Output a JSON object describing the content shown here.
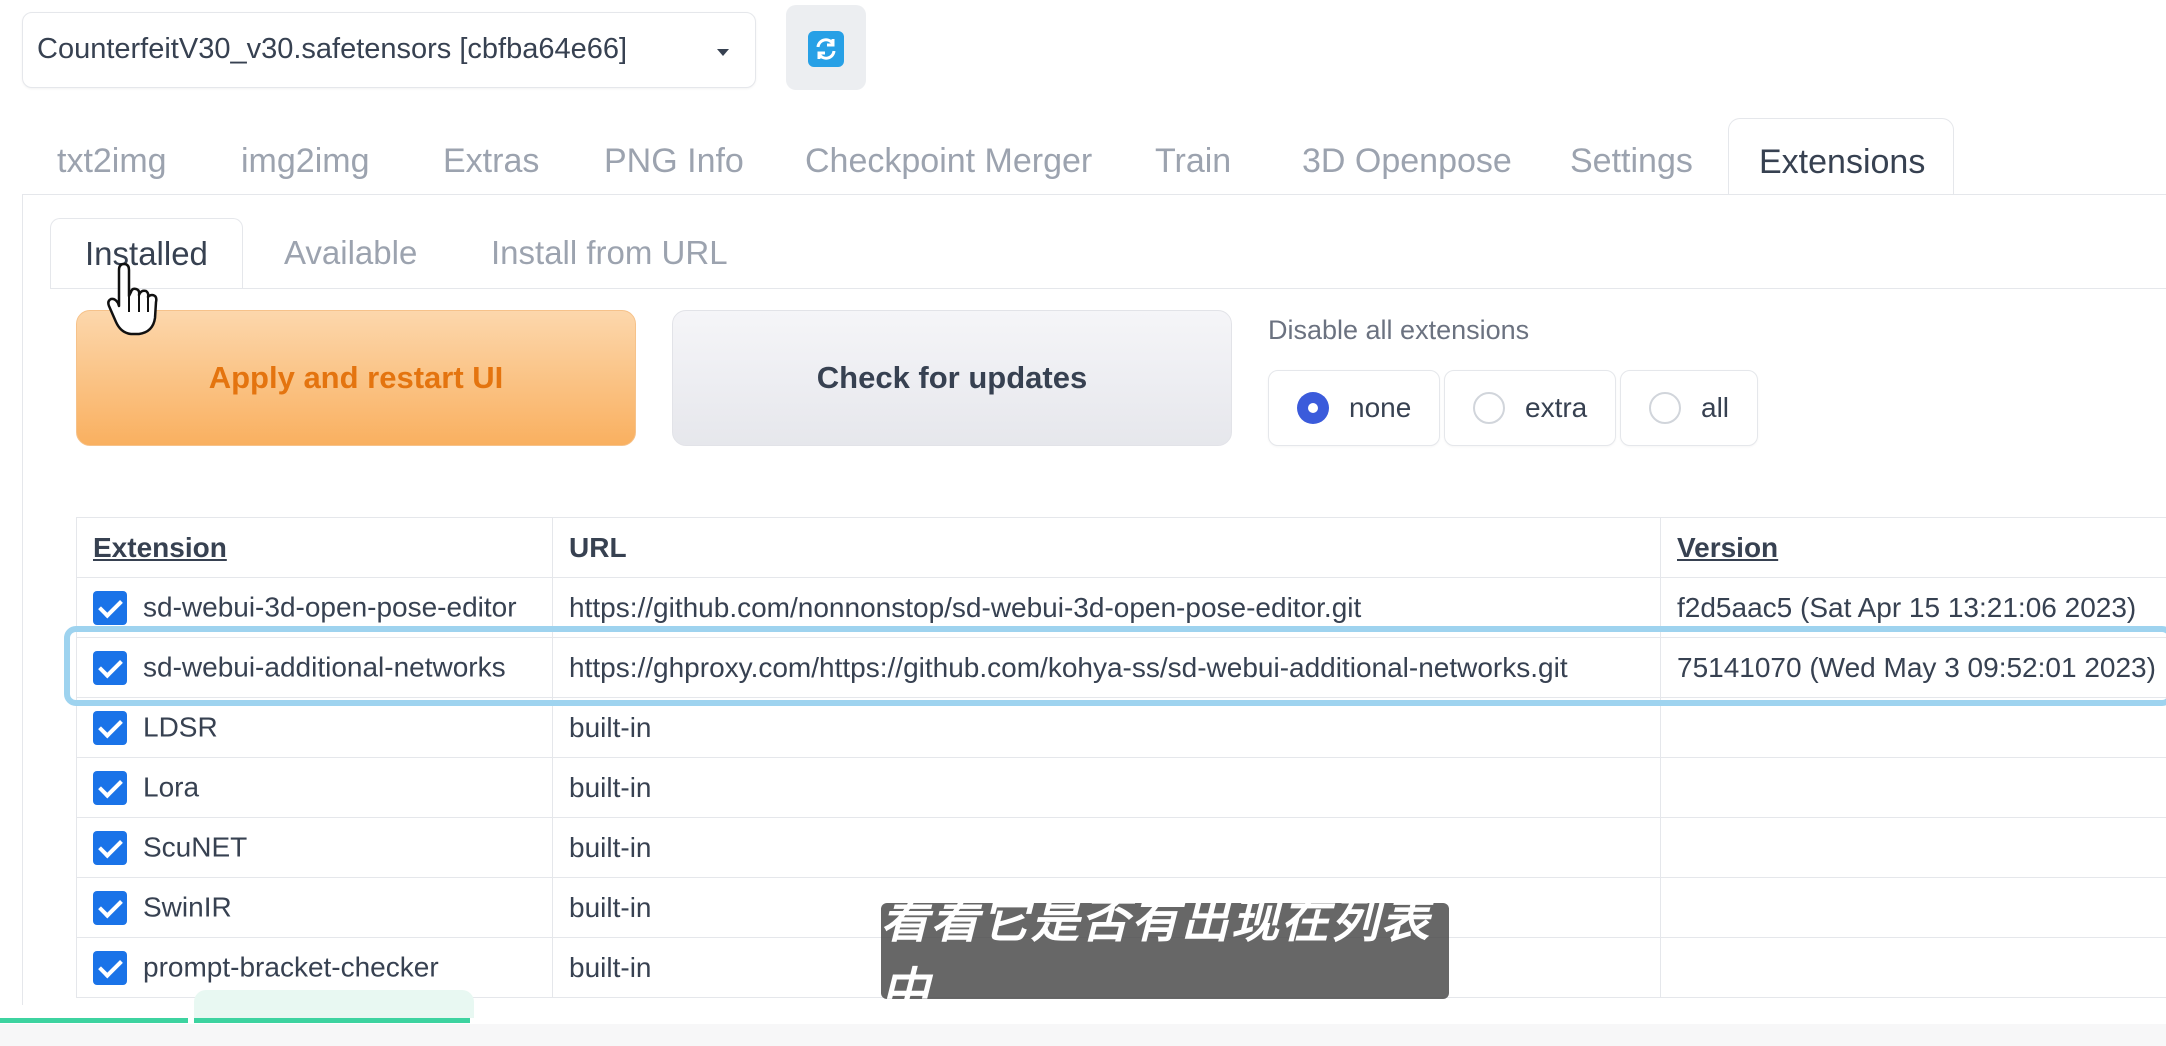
{
  "checkpoint": {
    "value": "CounterfeitV30_v30.safetensors [cbfba64e66]"
  },
  "main_tabs": [
    {
      "label": "txt2img"
    },
    {
      "label": "img2img"
    },
    {
      "label": "Extras"
    },
    {
      "label": "PNG Info"
    },
    {
      "label": "Checkpoint Merger"
    },
    {
      "label": "Train"
    },
    {
      "label": "3D Openpose"
    },
    {
      "label": "Settings"
    },
    {
      "label": "Extensions",
      "active": true
    }
  ],
  "sub_tabs": [
    {
      "label": "Installed",
      "active": true
    },
    {
      "label": "Available"
    },
    {
      "label": "Install from URL"
    }
  ],
  "buttons": {
    "apply": "Apply and restart UI",
    "check_updates": "Check for updates"
  },
  "disable_all": {
    "label": "Disable all extensions",
    "options": [
      "none",
      "extra",
      "all"
    ],
    "selected": "none"
  },
  "table": {
    "headers": [
      "Extension",
      "URL",
      "Version"
    ],
    "rows": [
      {
        "name": "sd-webui-3d-open-pose-editor",
        "url": "https://github.com/nonnonstop/sd-webui-3d-open-pose-editor.git",
        "version": "f2d5aac5 (Sat Apr 15 13:21:06 2023)",
        "checked": true
      },
      {
        "name": "sd-webui-additional-networks",
        "url": "https://ghproxy.com/https://github.com/kohya-ss/sd-webui-additional-networks.git",
        "version": "75141070 (Wed May 3 09:52:01 2023)",
        "checked": true
      },
      {
        "name": "LDSR",
        "url": "built-in",
        "version": "",
        "checked": true
      },
      {
        "name": "Lora",
        "url": "built-in",
        "version": "",
        "checked": true
      },
      {
        "name": "ScuNET",
        "url": "built-in",
        "version": "",
        "checked": true
      },
      {
        "name": "SwinIR",
        "url": "built-in",
        "version": "",
        "checked": true
      },
      {
        "name": "prompt-bracket-checker",
        "url": "built-in",
        "version": "",
        "checked": true
      }
    ]
  },
  "subtitle": "看看它是否有出现在列表中",
  "colors": {
    "accent_orange": "#e4740f",
    "checkbox_blue": "#1a73e8",
    "highlight": "#9ed3ef"
  }
}
